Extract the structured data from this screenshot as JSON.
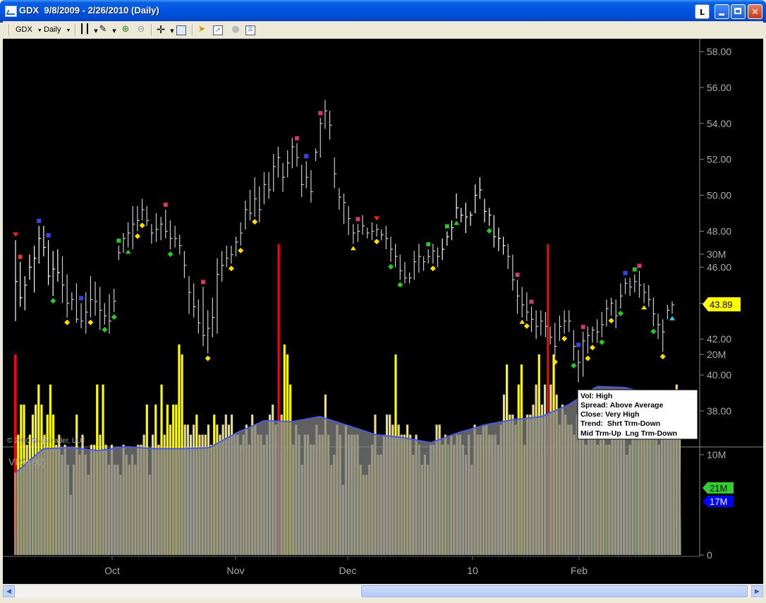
{
  "window": {
    "title": "GDX  9/8/2009 - 2/26/2010 (Daily)",
    "btn_link": "L"
  },
  "toolbar": {
    "instrument": "GDX",
    "interval": "Daily",
    "icons": [
      "bar-type-icon",
      "pencil-icon",
      "zoom-in-icon",
      "zoom-out-icon",
      "crosshair-icon",
      "data-box-icon",
      "strategies-icon",
      "indicators-icon",
      "disabled-circle-icon",
      "properties-icon"
    ]
  },
  "chart": {
    "copyright": "© 2010 NinjaTrader, LLC",
    "price_ticks": [
      "58.00",
      "56.00",
      "54.00",
      "52.00",
      "50.00",
      "48.00",
      "46.00",
      "44.00",
      "42.00",
      "40.00",
      "38.00"
    ],
    "current_price": "43.89",
    "info_box": [
      "Vol: High",
      "Spread: Above Average",
      "Close: Very High",
      "Trend:  Shrt Trm-Down",
      "Mid Trm-Up  Lng Trm-Down"
    ],
    "vpa_label": "VPA(30)",
    "volume_ticks": [
      "30M",
      "20M",
      "10M",
      "0"
    ],
    "volume_marker_1": "21M",
    "volume_marker_2": "17M",
    "x_labels": [
      "Oct",
      "Nov",
      "Dec",
      "10",
      "Feb"
    ],
    "colors": {
      "background": "#000000",
      "price_bar": "#ffffff",
      "volume_bar": "#e6dc8c",
      "volume_high": "#ffff00",
      "volume_climax": "#ff0000",
      "volume_green": "#33cc33",
      "average": "#4b5bdc",
      "current_price_tag": "#ffff00",
      "marker_21m": "#33cc33",
      "marker_17m": "#0000ff"
    }
  },
  "chart_data": {
    "type": "bar",
    "price_range": [
      36.5,
      58.5
    ],
    "volume_range": [
      0,
      31
    ],
    "x_months": [
      "Oct",
      "Nov",
      "Dec",
      "10",
      "Feb"
    ],
    "bars": [
      [
        47.5,
        43.0,
        45.2
      ],
      [
        46.3,
        43.8,
        44.3
      ],
      [
        45.5,
        43.6,
        45.0
      ],
      [
        46.7,
        45.3,
        46.0
      ],
      [
        47.2,
        44.6,
        46.5
      ],
      [
        48.3,
        46.2,
        47.6
      ],
      [
        48.3,
        46.6,
        47.1
      ],
      [
        47.5,
        45.0,
        45.5
      ],
      [
        46.9,
        44.4,
        45.9
      ],
      [
        47.0,
        45.2,
        45.7
      ],
      [
        46.6,
        44.0,
        45.0
      ],
      [
        45.6,
        43.2,
        44.0
      ],
      [
        44.6,
        43.6,
        44.2
      ],
      [
        45.1,
        42.9,
        43.1
      ],
      [
        44.0,
        42.6,
        43.0
      ],
      [
        44.6,
        42.3,
        43.5
      ],
      [
        45.5,
        43.2,
        44.2
      ],
      [
        45.2,
        43.3,
        44.1
      ],
      [
        44.9,
        42.5,
        43.6
      ],
      [
        44.0,
        42.8,
        43.3
      ],
      [
        44.5,
        42.3,
        43.0
      ],
      [
        44.8,
        43.5,
        44.1
      ],
      [
        47.2,
        46.4,
        46.8
      ],
      [
        47.9,
        46.8,
        47.6
      ],
      [
        48.5,
        47.1,
        47.9
      ],
      [
        49.4,
        47.0,
        48.4
      ],
      [
        49.4,
        48.0,
        48.6
      ],
      [
        49.8,
        48.6,
        49.2
      ],
      [
        49.4,
        48.3,
        48.6
      ],
      [
        48.4,
        47.3,
        47.9
      ],
      [
        49.0,
        47.4,
        48.1
      ],
      [
        48.8,
        47.5,
        48.4
      ],
      [
        49.2,
        47.6,
        48.0
      ],
      [
        48.6,
        47.0,
        47.6
      ],
      [
        48.3,
        47.1,
        47.6
      ],
      [
        47.8,
        46.7,
        47.2
      ],
      [
        46.9,
        45.4,
        46.1
      ],
      [
        45.5,
        43.4,
        44.6
      ],
      [
        45.1,
        43.2,
        43.8
      ],
      [
        44.2,
        42.3,
        42.9
      ],
      [
        44.9,
        41.6,
        42.2
      ],
      [
        43.6,
        41.2,
        42.6
      ],
      [
        44.3,
        42.1,
        43.2
      ],
      [
        46.5,
        42.3,
        45.6
      ],
      [
        46.9,
        45.2,
        46.1
      ],
      [
        47.2,
        46.0,
        46.5
      ],
      [
        47.2,
        46.2,
        46.7
      ],
      [
        47.7,
        46.6,
        47.4
      ],
      [
        48.5,
        47.2,
        47.9
      ],
      [
        49.7,
        48.1,
        49.2
      ],
      [
        50.3,
        48.6,
        49.0
      ],
      [
        51.0,
        48.8,
        49.8
      ],
      [
        50.5,
        48.5,
        49.2
      ],
      [
        51.3,
        49.5,
        50.6
      ],
      [
        51.3,
        49.8,
        50.3
      ],
      [
        52.3,
        50.2,
        51.6
      ],
      [
        52.7,
        51.0,
        52.1
      ],
      [
        51.8,
        50.2,
        51.0
      ],
      [
        52.5,
        51.0,
        51.8
      ],
      [
        53.2,
        51.5,
        52.7
      ],
      [
        52.9,
        51.6,
        52.1
      ],
      [
        51.7,
        49.9,
        50.6
      ],
      [
        51.9,
        50.4,
        51.0
      ],
      [
        51.4,
        49.6,
        50.2
      ],
      [
        52.6,
        51.9,
        52.4
      ],
      [
        54.3,
        52.1,
        54.0
      ],
      [
        55.3,
        53.7,
        54.7
      ],
      [
        54.7,
        53.1,
        53.9
      ],
      [
        52.1,
        50.4,
        51.2
      ],
      [
        50.4,
        49.2,
        49.9
      ],
      [
        50.1,
        48.4,
        49.6
      ],
      [
        49.4,
        47.8,
        48.7
      ],
      [
        48.4,
        47.3,
        47.9
      ],
      [
        48.4,
        47.4,
        48.0
      ],
      [
        48.9,
        47.8,
        48.3
      ],
      [
        48.2,
        47.6,
        47.9
      ],
      [
        48.5,
        47.5,
        48.0
      ],
      [
        48.4,
        47.7,
        48.1
      ],
      [
        48.1,
        47.5,
        47.8
      ],
      [
        48.3,
        47.0,
        47.6
      ],
      [
        47.7,
        46.3,
        47.0
      ],
      [
        47.3,
        46.0,
        46.6
      ],
      [
        46.7,
        45.3,
        45.8
      ],
      [
        46.3,
        45.1,
        45.4
      ],
      [
        45.7,
        45.1,
        45.4
      ],
      [
        46.9,
        45.3,
        46.3
      ],
      [
        47.3,
        45.7,
        46.6
      ],
      [
        46.6,
        45.8,
        46.3
      ],
      [
        47.0,
        46.2,
        46.6
      ],
      [
        47.3,
        46.2,
        46.9
      ],
      [
        47.1,
        46.0,
        46.6
      ],
      [
        47.6,
        46.4,
        47.0
      ],
      [
        48.0,
        47.2,
        47.7
      ],
      [
        48.6,
        47.5,
        48.2
      ],
      [
        50.1,
        48.7,
        49.3
      ],
      [
        49.3,
        48.5,
        48.9
      ],
      [
        49.6,
        47.9,
        48.8
      ],
      [
        49.1,
        48.3,
        48.9
      ],
      [
        50.6,
        49.0,
        50.0
      ],
      [
        51.0,
        49.8,
        50.3
      ],
      [
        49.8,
        48.5,
        49.1
      ],
      [
        49.3,
        48.3,
        48.9
      ],
      [
        48.9,
        47.1,
        47.7
      ],
      [
        48.2,
        46.9,
        47.6
      ],
      [
        47.7,
        46.7,
        47.2
      ],
      [
        47.3,
        45.9,
        46.6
      ],
      [
        46.7,
        44.7,
        45.3
      ],
      [
        45.3,
        43.4,
        44.4
      ],
      [
        44.9,
        43.2,
        43.9
      ],
      [
        44.6,
        43.0,
        43.5
      ],
      [
        43.8,
        42.4,
        43.1
      ],
      [
        43.6,
        42.0,
        42.7
      ],
      [
        43.6,
        42.2,
        43.0
      ],
      [
        43.5,
        42.1,
        42.7
      ],
      [
        42.7,
        41.7,
        42.1
      ],
      [
        42.9,
        41.0,
        41.6
      ],
      [
        43.3,
        41.9,
        42.7
      ],
      [
        43.6,
        42.3,
        43.0
      ],
      [
        43.6,
        42.4,
        43.0
      ],
      [
        42.5,
        40.8,
        41.6
      ],
      [
        41.4,
        39.6,
        40.7
      ],
      [
        42.4,
        39.9,
        41.9
      ],
      [
        42.7,
        41.2,
        42.2
      ],
      [
        42.7,
        41.8,
        42.5
      ],
      [
        43.1,
        41.8,
        42.4
      ],
      [
        43.5,
        42.1,
        42.8
      ],
      [
        44.2,
        42.7,
        43.7
      ],
      [
        44.3,
        43.3,
        44.0
      ],
      [
        44.2,
        42.6,
        43.3
      ],
      [
        45.1,
        43.7,
        44.4
      ],
      [
        45.4,
        44.5,
        45.1
      ],
      [
        45.4,
        44.4,
        44.9
      ],
      [
        45.6,
        44.6,
        45.2
      ],
      [
        45.8,
        44.3,
        45.0
      ],
      [
        45.1,
        44.0,
        44.6
      ],
      [
        45.0,
        43.8,
        44.2
      ],
      [
        44.3,
        42.7,
        43.4
      ],
      [
        43.4,
        42.0,
        42.8
      ],
      [
        43.1,
        41.3,
        42.4
      ],
      [
        43.9,
        43.1,
        43.6
      ],
      [
        44.1,
        43.4,
        43.9
      ]
    ],
    "volume_millions": [
      20,
      12,
      15,
      15,
      11,
      12,
      14,
      15,
      17,
      15,
      12,
      14,
      17,
      14,
      11,
      12,
      10,
      11,
      9,
      6,
      9,
      14,
      10,
      12,
      10,
      8,
      11,
      11,
      17,
      12,
      17,
      11,
      9,
      11,
      9,
      9,
      8,
      11,
      10,
      9,
      10,
      9,
      11,
      11,
      12,
      15,
      8,
      12,
      15,
      11,
      17,
      12,
      15,
      13,
      15,
      15,
      21,
      20,
      13,
      13,
      12,
      13,
      14,
      12,
      12,
      12,
      13,
      11,
      14,
      13,
      12,
      13,
      14,
      13,
      14,
      12,
      12,
      11,
      12,
      13,
      11,
      14,
      13,
      12,
      12,
      11,
      12,
      14,
      15,
      13,
      32,
      14,
      21,
      20,
      17,
      11,
      13,
      12,
      9,
      12,
      12,
      11,
      11,
      13,
      12,
      12,
      16,
      12,
      9,
      10,
      13,
      12,
      7,
      13,
      12,
      12,
      12,
      12,
      9,
      8,
      8,
      9,
      11,
      14,
      10,
      10,
      12,
      14,
      14,
      13,
      20,
      13,
      12,
      12,
      13,
      12,
      10,
      12,
      11,
      9,
      10,
      9,
      11,
      11,
      13,
      13,
      11,
      12,
      11,
      12,
      11,
      12,
      12,
      11,
      10,
      12,
      9,
      13,
      12,
      12,
      13,
      13,
      12,
      12,
      12,
      11,
      13,
      16,
      19,
      14,
      14,
      13,
      17,
      19,
      11,
      14,
      14,
      15,
      17,
      20,
      15,
      17,
      31,
      17,
      20,
      16,
      13,
      15,
      14,
      13,
      13,
      12,
      14,
      13,
      12,
      11,
      12,
      13,
      12,
      11,
      13,
      15,
      11,
      11,
      13,
      12,
      14,
      13,
      12,
      10,
      11,
      13,
      12,
      12,
      14,
      15,
      13,
      12,
      15,
      13,
      11,
      12,
      14,
      13,
      12,
      13,
      17,
      13
    ],
    "volume_average_millions": [
      8.2,
      10.6,
      10.7,
      10.4,
      10.8,
      10.6,
      10.6,
      10.7,
      12.2,
      13.4,
      13.3,
      13.8,
      12.9,
      12.0,
      11.7,
      11.2,
      12.2,
      13.0,
      13.5,
      13.8,
      15.0,
      16.8,
      16.7,
      16.0,
      15.0
    ],
    "markers": [
      {
        "bar": 0,
        "type": "tri-down",
        "color": "#ff2222"
      },
      {
        "bar": 1,
        "type": "square",
        "color": "#ee3333"
      },
      {
        "bar": 5,
        "type": "square",
        "color": "#3344ff"
      },
      {
        "bar": 7,
        "type": "square",
        "color": "#3344ff"
      },
      {
        "bar": 8,
        "type": "diamond",
        "color": "#22cc22"
      },
      {
        "bar": 11,
        "type": "diamond",
        "color": "#ffdd00"
      },
      {
        "bar": 14,
        "type": "square",
        "color": "#3344ff"
      },
      {
        "bar": 16,
        "type": "diamond",
        "color": "#ffdd00"
      },
      {
        "bar": 19,
        "type": "diamond",
        "color": "#22cc22"
      },
      {
        "bar": 21,
        "type": "diamond",
        "color": "#22cc22"
      },
      {
        "bar": 22,
        "type": "square",
        "color": "#22cc22"
      },
      {
        "bar": 24,
        "type": "tri-up",
        "color": "#22cc22"
      },
      {
        "bar": 26,
        "type": "diamond",
        "color": "#ffdd00"
      },
      {
        "bar": 27,
        "type": "diamond",
        "color": "#ffdd00"
      },
      {
        "bar": 32,
        "type": "square",
        "color": "#dd3377"
      },
      {
        "bar": 33,
        "type": "diamond",
        "color": "#22cc22"
      },
      {
        "bar": 40,
        "type": "square",
        "color": "#dd3377"
      },
      {
        "bar": 41,
        "type": "diamond",
        "color": "#ffdd00"
      },
      {
        "bar": 46,
        "type": "diamond",
        "color": "#ffdd00"
      },
      {
        "bar": 48,
        "type": "diamond",
        "color": "#ffdd00"
      },
      {
        "bar": 51,
        "type": "diamond",
        "color": "#ffdd00"
      },
      {
        "bar": 60,
        "type": "square",
        "color": "#dd3377"
      },
      {
        "bar": 62,
        "type": "square",
        "color": "#3344ff"
      },
      {
        "bar": 65,
        "type": "square",
        "color": "#dd3377"
      },
      {
        "bar": 72,
        "type": "tri-up",
        "color": "#ffdd00"
      },
      {
        "bar": 73,
        "type": "square",
        "color": "#dd3377"
      },
      {
        "bar": 77,
        "type": "tri-down",
        "color": "#ff2222"
      },
      {
        "bar": 77,
        "type": "diamond",
        "color": "#ffdd00"
      },
      {
        "bar": 80,
        "type": "diamond",
        "color": "#22cc22"
      },
      {
        "bar": 82,
        "type": "diamond",
        "color": "#22cc22"
      },
      {
        "bar": 88,
        "type": "square",
        "color": "#22cc22"
      },
      {
        "bar": 89,
        "type": "diamond",
        "color": "#ffdd00"
      },
      {
        "bar": 92,
        "type": "square",
        "color": "#22cc22"
      },
      {
        "bar": 94,
        "type": "tri-up",
        "color": "#22cc22"
      },
      {
        "bar": 101,
        "type": "diamond",
        "color": "#22cc22"
      },
      {
        "bar": 107,
        "type": "square",
        "color": "#dd3377"
      },
      {
        "bar": 108,
        "type": "tri-up",
        "color": "#ffdd00"
      },
      {
        "bar": 109,
        "type": "diamond",
        "color": "#ffdd00"
      },
      {
        "bar": 110,
        "type": "square",
        "color": "#dd3377"
      },
      {
        "bar": 115,
        "type": "diamond",
        "color": "#ffdd00"
      },
      {
        "bar": 117,
        "type": "diamond",
        "color": "#ffdd00"
      },
      {
        "bar": 119,
        "type": "diamond",
        "color": "#22cc22"
      },
      {
        "bar": 120,
        "type": "square",
        "color": "#3344ff"
      },
      {
        "bar": 121,
        "type": "square",
        "color": "#dd3377"
      },
      {
        "bar": 122,
        "type": "diamond",
        "color": "#ffdd00"
      },
      {
        "bar": 123,
        "type": "diamond",
        "color": "#ffdd00"
      },
      {
        "bar": 125,
        "type": "diamond",
        "color": "#22cc22"
      },
      {
        "bar": 127,
        "type": "diamond",
        "color": "#ffdd00"
      },
      {
        "bar": 129,
        "type": "diamond",
        "color": "#22cc22"
      },
      {
        "bar": 130,
        "type": "square",
        "color": "#3344ff"
      },
      {
        "bar": 132,
        "type": "square",
        "color": "#22cc22"
      },
      {
        "bar": 133,
        "type": "square",
        "color": "#dd3377"
      },
      {
        "bar": 134,
        "type": "tri-up",
        "color": "#ffdd00"
      },
      {
        "bar": 136,
        "type": "diamond",
        "color": "#22cc22"
      },
      {
        "bar": 138,
        "type": "diamond",
        "color": "#ffdd00"
      },
      {
        "bar": 140,
        "type": "tri-up",
        "color": "#22dddd"
      }
    ]
  }
}
